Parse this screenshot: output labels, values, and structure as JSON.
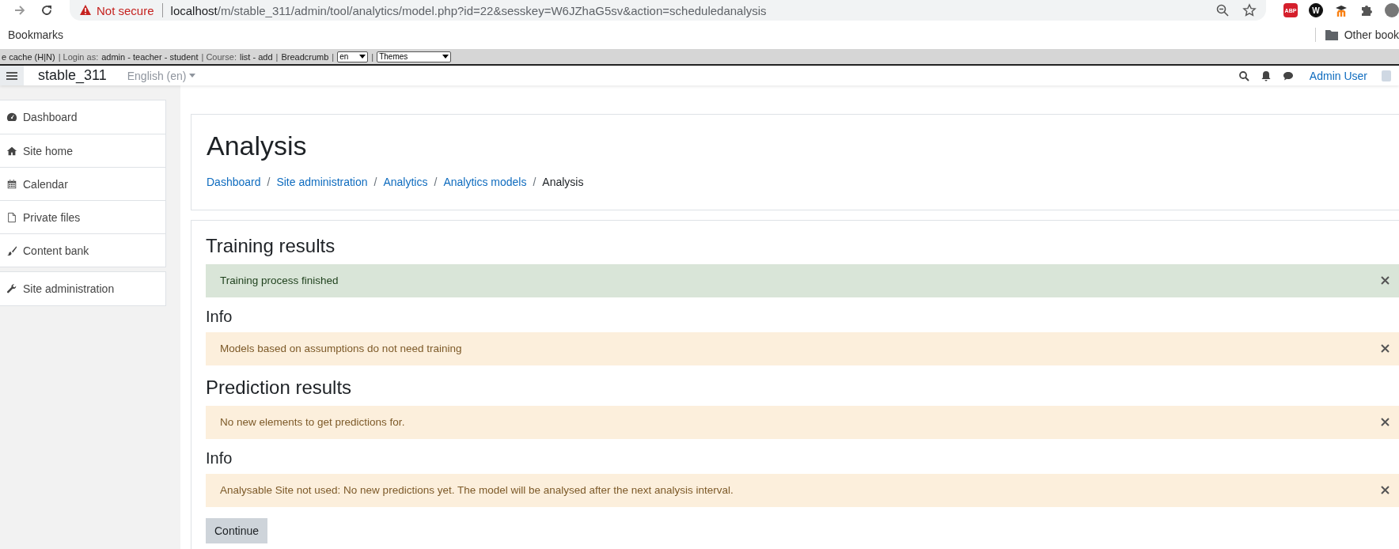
{
  "browser": {
    "security_label": "Not secure",
    "url_host": "localhost",
    "url_path": "/m/stable_311/admin/tool/analytics/model.php?id=22&sesskey=W6JZhaG5sv&action=scheduledanalysis",
    "extensions": [
      {
        "kind": "abp",
        "text": "ABP"
      },
      {
        "kind": "w",
        "text": "W"
      },
      {
        "kind": "moodle"
      },
      {
        "kind": "puzzle"
      }
    ],
    "bookmarks_label": "Bookmarks",
    "other_bookmarks": "Other book"
  },
  "dev_bar": [
    {
      "kind": "link",
      "text": "e cache (H|N)"
    },
    {
      "kind": "text",
      "text": "| Login as:"
    },
    {
      "kind": "link",
      "text": "admin - teacher - student"
    },
    {
      "kind": "text",
      "text": "| Course:"
    },
    {
      "kind": "link",
      "text": "list - add"
    },
    {
      "kind": "text",
      "text": "|"
    },
    {
      "kind": "link",
      "text": "Breadcrumb"
    },
    {
      "kind": "text",
      "text": "|"
    },
    {
      "kind": "select",
      "text": "en"
    },
    {
      "kind": "text",
      "text": "|"
    },
    {
      "kind": "select",
      "text": "Themes"
    }
  ],
  "navbar": {
    "site_name": "stable_311",
    "language": "English (en)",
    "user_name": "Admin User"
  },
  "sidebar": {
    "groups": [
      [
        {
          "kind": "dashboard",
          "label": "Dashboard"
        },
        {
          "kind": "home",
          "label": "Site home"
        },
        {
          "kind": "calendar",
          "label": "Calendar"
        },
        {
          "kind": "file",
          "label": "Private files"
        },
        {
          "kind": "brush",
          "label": "Content bank"
        }
      ],
      [
        {
          "kind": "wrench",
          "label": "Site administration"
        }
      ]
    ]
  },
  "page": {
    "title": "Analysis",
    "breadcrumb": [
      {
        "kind": "link",
        "text": "Dashboard"
      },
      {
        "kind": "separator",
        "text": "/"
      },
      {
        "kind": "link",
        "text": "Site administration"
      },
      {
        "kind": "separator",
        "text": "/"
      },
      {
        "kind": "link",
        "text": "Analytics"
      },
      {
        "kind": "separator",
        "text": "/"
      },
      {
        "kind": "link",
        "text": "Analytics models"
      },
      {
        "kind": "separator",
        "text": "/"
      },
      {
        "kind": "current",
        "text": "Analysis"
      }
    ]
  },
  "results": [
    {
      "kind": "major",
      "heading": "Training results",
      "alert": {
        "kind": "success",
        "text": "Training process finished"
      }
    },
    {
      "kind": "minor",
      "heading": "Info",
      "alert": {
        "kind": "warning",
        "text": "Models based on assumptions do not need training"
      }
    },
    {
      "kind": "major",
      "heading": "Prediction results",
      "alert": {
        "kind": "warning",
        "text": "No new elements to get predictions for."
      }
    },
    {
      "kind": "minor",
      "heading": "Info",
      "alert": {
        "kind": "warning",
        "text": "Analysable Site not used: No new predictions yet. The model will be analysed after the next analysis interval."
      }
    }
  ],
  "continue_button": "Continue"
}
